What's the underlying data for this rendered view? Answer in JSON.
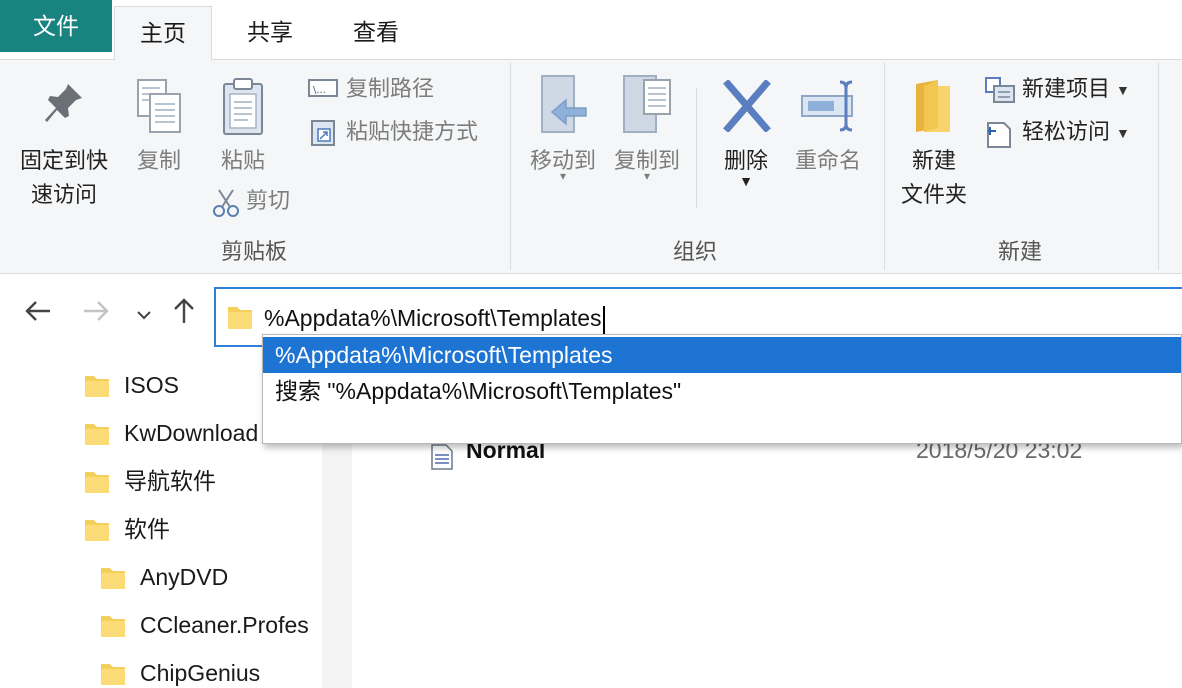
{
  "tabs": {
    "file": "文件",
    "home": "主页",
    "share": "共享",
    "view": "查看"
  },
  "ribbon": {
    "clipboard": {
      "pin_line1": "固定到快",
      "pin_line2": "速访问",
      "copy": "复制",
      "paste": "粘贴",
      "copy_path": "复制路径",
      "paste_shortcut": "粘贴快捷方式",
      "cut": "剪切",
      "group_label": "剪贴板"
    },
    "organize": {
      "move_to": "移动到",
      "copy_to": "复制到",
      "delete": "删除",
      "rename": "重命名",
      "group_label": "组织"
    },
    "new": {
      "new_folder_line1": "新建",
      "new_folder_line2": "文件夹",
      "new_item": "新建项目",
      "easy_access": "轻松访问",
      "group_label": "新建"
    }
  },
  "address_bar": {
    "value": "%Appdata%\\Microsoft\\Templates"
  },
  "autocomplete": {
    "suggestion": "%Appdata%\\Microsoft\\Templates",
    "search": "搜索 \"%Appdata%\\Microsoft\\Templates\""
  },
  "tree": {
    "items": [
      {
        "label": "ISOS"
      },
      {
        "label": "KwDownload"
      },
      {
        "label": "导航软件"
      },
      {
        "label": "软件"
      },
      {
        "label": "AnyDVD"
      },
      {
        "label": "CCleaner.Profes"
      },
      {
        "label": "ChipGenius"
      }
    ]
  },
  "files": [
    {
      "name": "Normal",
      "date": "2018/5/20 23:02"
    }
  ],
  "colors": {
    "file_tab": "#198380",
    "accent": "#1e74d2",
    "folder": "#f5cf5b"
  }
}
